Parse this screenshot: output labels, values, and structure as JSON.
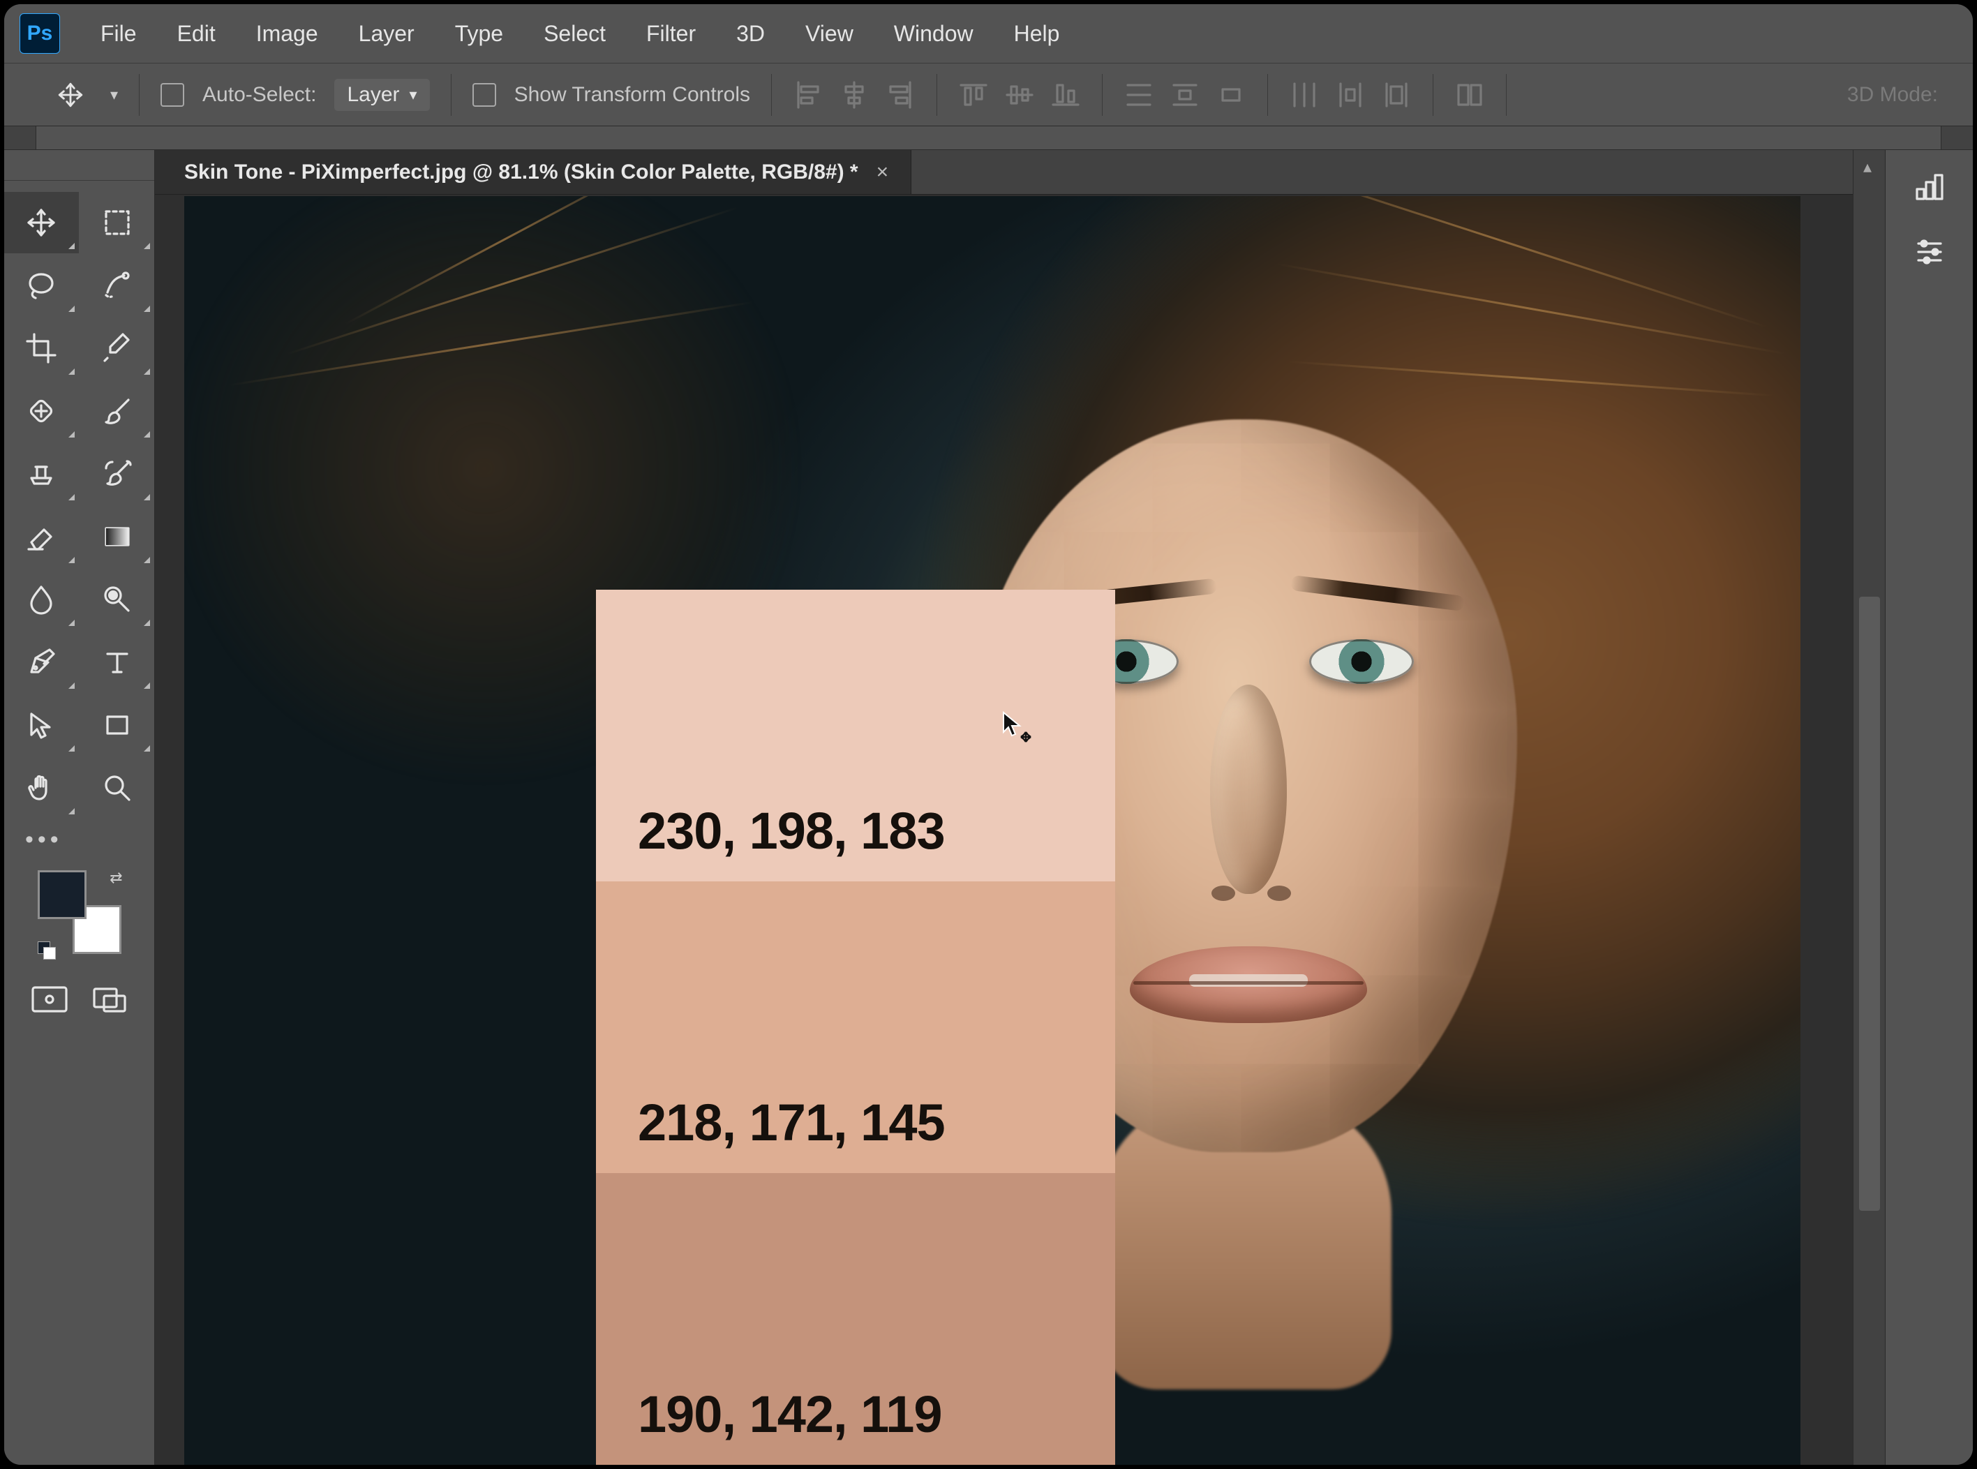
{
  "app": {
    "logo": "Ps"
  },
  "menu": [
    "File",
    "Edit",
    "Image",
    "Layer",
    "Type",
    "Select",
    "Filter",
    "3D",
    "View",
    "Window",
    "Help"
  ],
  "options": {
    "auto_select_label": "Auto-Select:",
    "target": "Layer",
    "show_transform_label": "Show Transform Controls",
    "d3_mode_label": "3D Mode:"
  },
  "document": {
    "tab_title": "Skin Tone - PiXimperfect.jpg @ 81.1% (Skin Color Palette, RGB/8#) *"
  },
  "palette": {
    "swatches": [
      {
        "label": "230, 198, 183",
        "hex": "#edcab9"
      },
      {
        "label": "218, 171, 145",
        "hex": "#deae93"
      },
      {
        "label": "190, 142, 119",
        "hex": "#c4937b"
      }
    ]
  },
  "colors": {
    "foreground": "#16202c",
    "background": "#ffffff"
  },
  "tools": {
    "row1": [
      "move-tool",
      "marquee-tool"
    ],
    "row2": [
      "lasso-tool",
      "quick-select-tool"
    ],
    "row3": [
      "crop-tool",
      "eyedropper-tool"
    ],
    "row4": [
      "spot-heal-tool",
      "brush-tool"
    ],
    "row5": [
      "clone-stamp-tool",
      "history-brush-tool"
    ],
    "row6": [
      "eraser-tool",
      "gradient-tool"
    ],
    "row7": [
      "blur-tool",
      "dodge-tool"
    ],
    "row8": [
      "pen-tool",
      "type-tool"
    ],
    "row9": [
      "path-select-tool",
      "rectangle-shape-tool"
    ],
    "row10": [
      "hand-tool",
      "zoom-tool"
    ]
  }
}
